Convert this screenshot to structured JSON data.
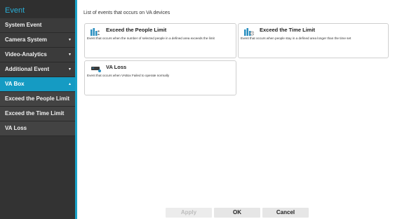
{
  "sidebar": {
    "header": "Event",
    "items": [
      {
        "label": "System Event",
        "arrow": ""
      },
      {
        "label": "Camera System",
        "arrow": "▾"
      },
      {
        "label": "Video-Analytics",
        "arrow": "▾"
      },
      {
        "label": "Additional Event",
        "arrow": "▾"
      },
      {
        "label": "VA Box",
        "arrow": "▴"
      },
      {
        "label": "Exceed the People Limit",
        "arrow": ""
      },
      {
        "label": "Exceed the Time Limit",
        "arrow": ""
      },
      {
        "label": "VA Loss",
        "arrow": ""
      }
    ]
  },
  "main": {
    "title": "List of events that occurs on VA devices",
    "cards": [
      {
        "title": "Exceed the People Limit",
        "description": "Event that occurs when the number of selected people in a defined area exceeds the limit",
        "icon": "people-chart-icon"
      },
      {
        "title": "Exceed the Time Limit",
        "description": "Event that occurs when people stay in a defined area longer than the time set",
        "icon": "time-chart-icon"
      },
      {
        "title": "VA Loss",
        "description": "Event that occurs when VABox Failed to operate normally",
        "icon": "vabox-device-icon"
      }
    ]
  },
  "footer": {
    "apply_label": "Apply",
    "ok_label": "OK",
    "cancel_label": "Cancel"
  },
  "colors": {
    "accent": "#159bc3",
    "sidebar_bg": "#2f2f2f",
    "header_text": "#2aaed6"
  }
}
